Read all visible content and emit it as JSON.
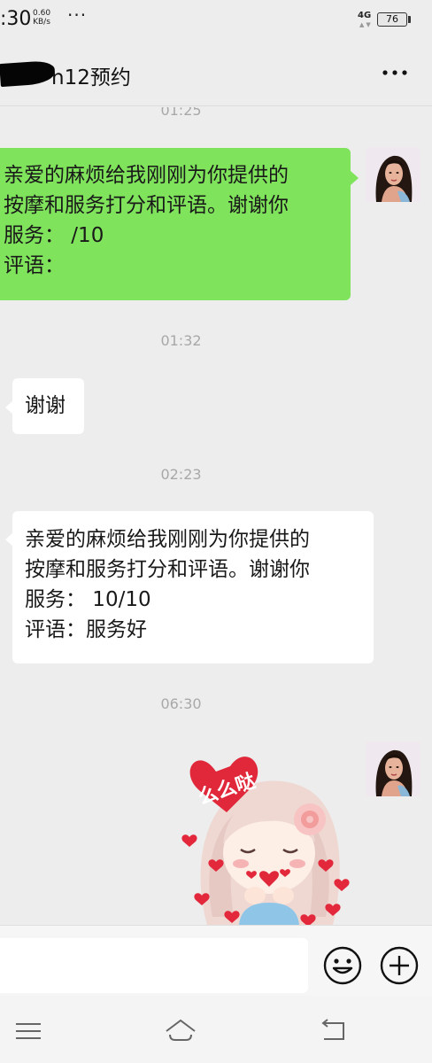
{
  "status_bar": {
    "time": ":30",
    "speed_value": "0.60",
    "speed_unit": "KB/s",
    "more_dots": "···",
    "network": "4G",
    "battery": "76"
  },
  "header": {
    "title": "n12预约",
    "more_icon": "more-dots-icon"
  },
  "messages": [
    {
      "type": "time",
      "text": "01:25"
    },
    {
      "type": "outgoing",
      "lines": [
        "亲爱的麻烦给我刚刚为你提供的",
        "按摩和服务打分和评语。谢谢你",
        "服务：  /10",
        "评语："
      ]
    },
    {
      "type": "time",
      "text": "01:32"
    },
    {
      "type": "incoming",
      "lines": [
        "谢谢"
      ]
    },
    {
      "type": "time",
      "text": "02:23"
    },
    {
      "type": "incoming",
      "lines": [
        "亲爱的麻烦给我刚刚为你提供的",
        "按摩和服务打分和评语。谢谢你",
        "服务：  10/10",
        "评语：服务好"
      ]
    },
    {
      "type": "time",
      "text": "06:30"
    },
    {
      "type": "outgoing_sticker",
      "sticker_text": "么么哒"
    }
  ],
  "input_bar": {
    "emoji_icon": "smiley-icon",
    "add_icon": "plus-circle-icon"
  },
  "nav_bar": {
    "menu_icon": "menu-icon",
    "home_icon": "home-icon",
    "back_icon": "back-icon"
  },
  "colors": {
    "chat_bg": "#ededed",
    "outgoing_bubble": "#7fe35c",
    "incoming_bubble": "#ffffff",
    "time_text": "#a8a8a8"
  }
}
